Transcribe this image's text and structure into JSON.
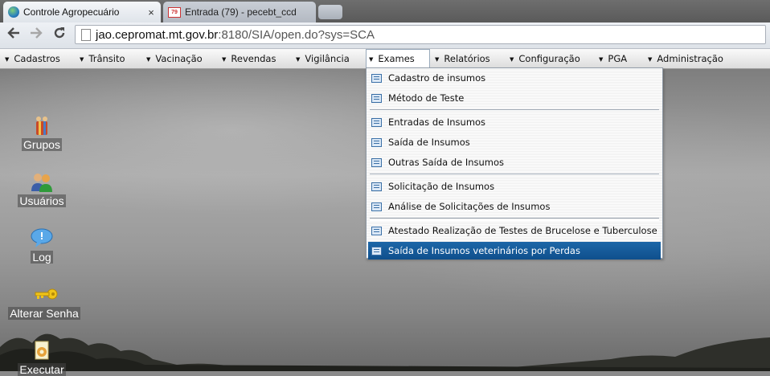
{
  "browser": {
    "tabs": [
      {
        "title": "Controle Agropecuário",
        "icon": "globe-icon",
        "active": true
      },
      {
        "title": "Entrada (79) - pecebt_ccd",
        "icon": "gmail-icon",
        "badge": "79",
        "active": false
      }
    ],
    "close_glyph": "×",
    "address": {
      "host": "jao.cepromat.mt.gov.br",
      "rest": ":8180/SIA/open.do?sys=SCA"
    }
  },
  "menubar": {
    "items": [
      {
        "label": "Cadastros"
      },
      {
        "label": "Trânsito"
      },
      {
        "label": "Vacinação"
      },
      {
        "label": "Revendas"
      },
      {
        "label": "Vigilância"
      },
      {
        "label": "Exames",
        "open": true
      },
      {
        "label": "Relatórios"
      },
      {
        "label": "Configuração"
      },
      {
        "label": "PGA"
      },
      {
        "label": "Administração"
      }
    ]
  },
  "dropdown": {
    "items": [
      {
        "label": "Cadastro de insumos"
      },
      {
        "label": "Método de Teste"
      },
      {
        "label": "Entradas de Insumos"
      },
      {
        "label": "Saída de Insumos"
      },
      {
        "label": "Outras Saída de Insumos"
      },
      {
        "label": "Solicitação de Insumos"
      },
      {
        "label": "Análise de Solicitações de Insumos"
      },
      {
        "label": "Atestado Realização de Testes de Brucelose e Tuberculose"
      },
      {
        "label": "Saída de Insumos veterinários por Perdas",
        "selected": true
      }
    ]
  },
  "desktop": {
    "icons": [
      {
        "label": "Grupos",
        "icon": "groups-icon"
      },
      {
        "label": "Usuários",
        "icon": "users-icon"
      },
      {
        "label": "Log",
        "icon": "log-icon"
      },
      {
        "label": "Alterar Senha",
        "icon": "key-icon"
      },
      {
        "label": "Executar",
        "icon": "execute-icon"
      }
    ]
  },
  "colors": {
    "selection": "#1d67a8",
    "menubar": "#e8e8e8"
  }
}
